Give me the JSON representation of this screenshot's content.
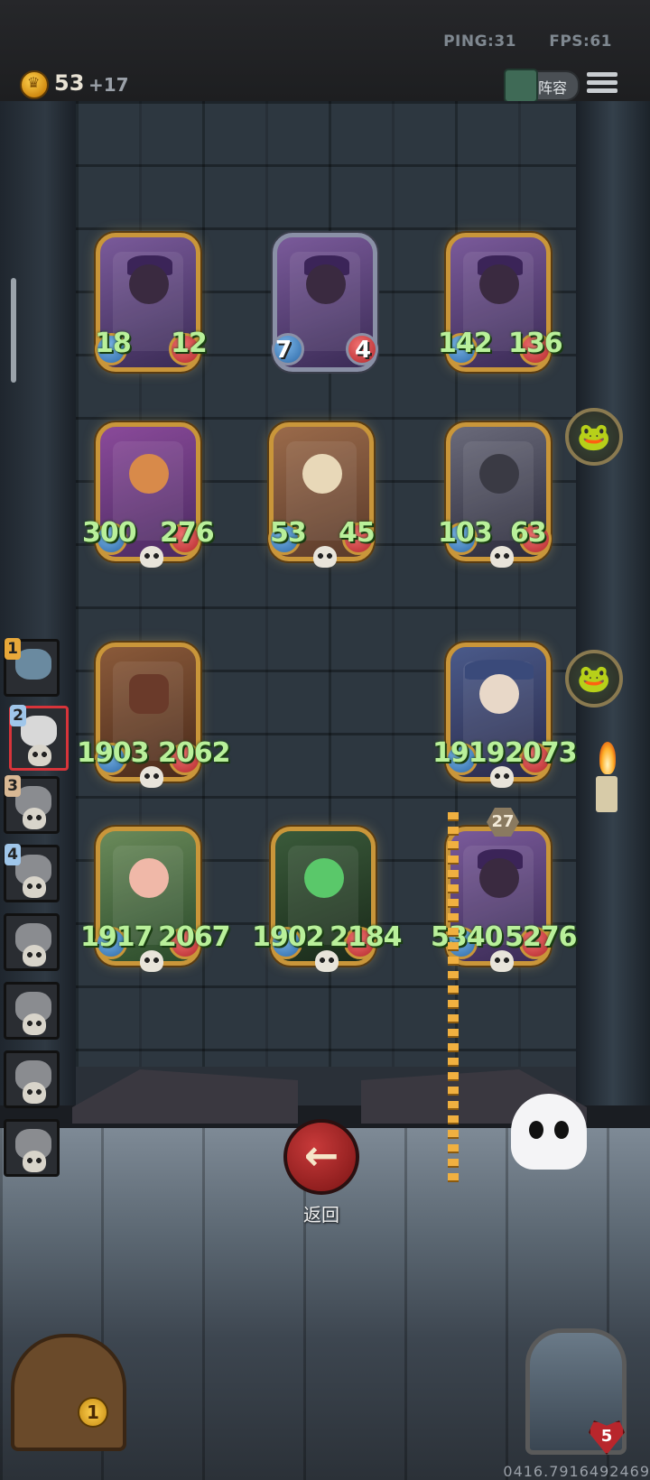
{
  "status": {
    "ping": "PING:31",
    "fps": "FPS:61"
  },
  "economy": {
    "gold": "53",
    "income": "+17"
  },
  "header": {
    "lineup_label": "阵容"
  },
  "board": {
    "row1": [
      {
        "attack": "18",
        "health": "12",
        "variant": "gold"
      },
      {
        "attack": "7",
        "health": "4",
        "variant": "silver"
      },
      {
        "attack": "142",
        "health": "136",
        "variant": "gold"
      }
    ],
    "row2": [
      {
        "attack": "300",
        "health": "276"
      },
      {
        "attack": "53",
        "health": "45"
      },
      {
        "attack": "103",
        "health": "63"
      }
    ],
    "row3": [
      {
        "attack": "1903",
        "health": "2062"
      },
      {
        "attack": "1919",
        "health": "2073"
      }
    ],
    "row4": [
      {
        "attack": "1917",
        "health": "2067"
      },
      {
        "attack": "1902",
        "health": "2184"
      },
      {
        "attack": "5340",
        "health": "5276",
        "level": "27"
      }
    ]
  },
  "opponents": [
    {
      "rank": "1",
      "rank_color": "#e8a83a"
    },
    {
      "rank": "2",
      "rank_color": "#9fc6ea"
    },
    {
      "rank": "3",
      "rank_color": "#d8b894"
    },
    {
      "rank": "4",
      "rank_color": "#9fc6ea"
    },
    {
      "rank": ""
    },
    {
      "rank": ""
    },
    {
      "rank": ""
    },
    {
      "rank": ""
    }
  ],
  "controls": {
    "back_label": "返回",
    "back_icon": "arrow-left-icon"
  },
  "tavern": {
    "count": "1"
  },
  "hero": {
    "health": "5"
  },
  "footer": {
    "coordinate": "0416.7916492469"
  },
  "colors": {
    "stat_green": "#b9f09a",
    "gold_frame": "#c9963a",
    "back_red": "#b02828"
  }
}
